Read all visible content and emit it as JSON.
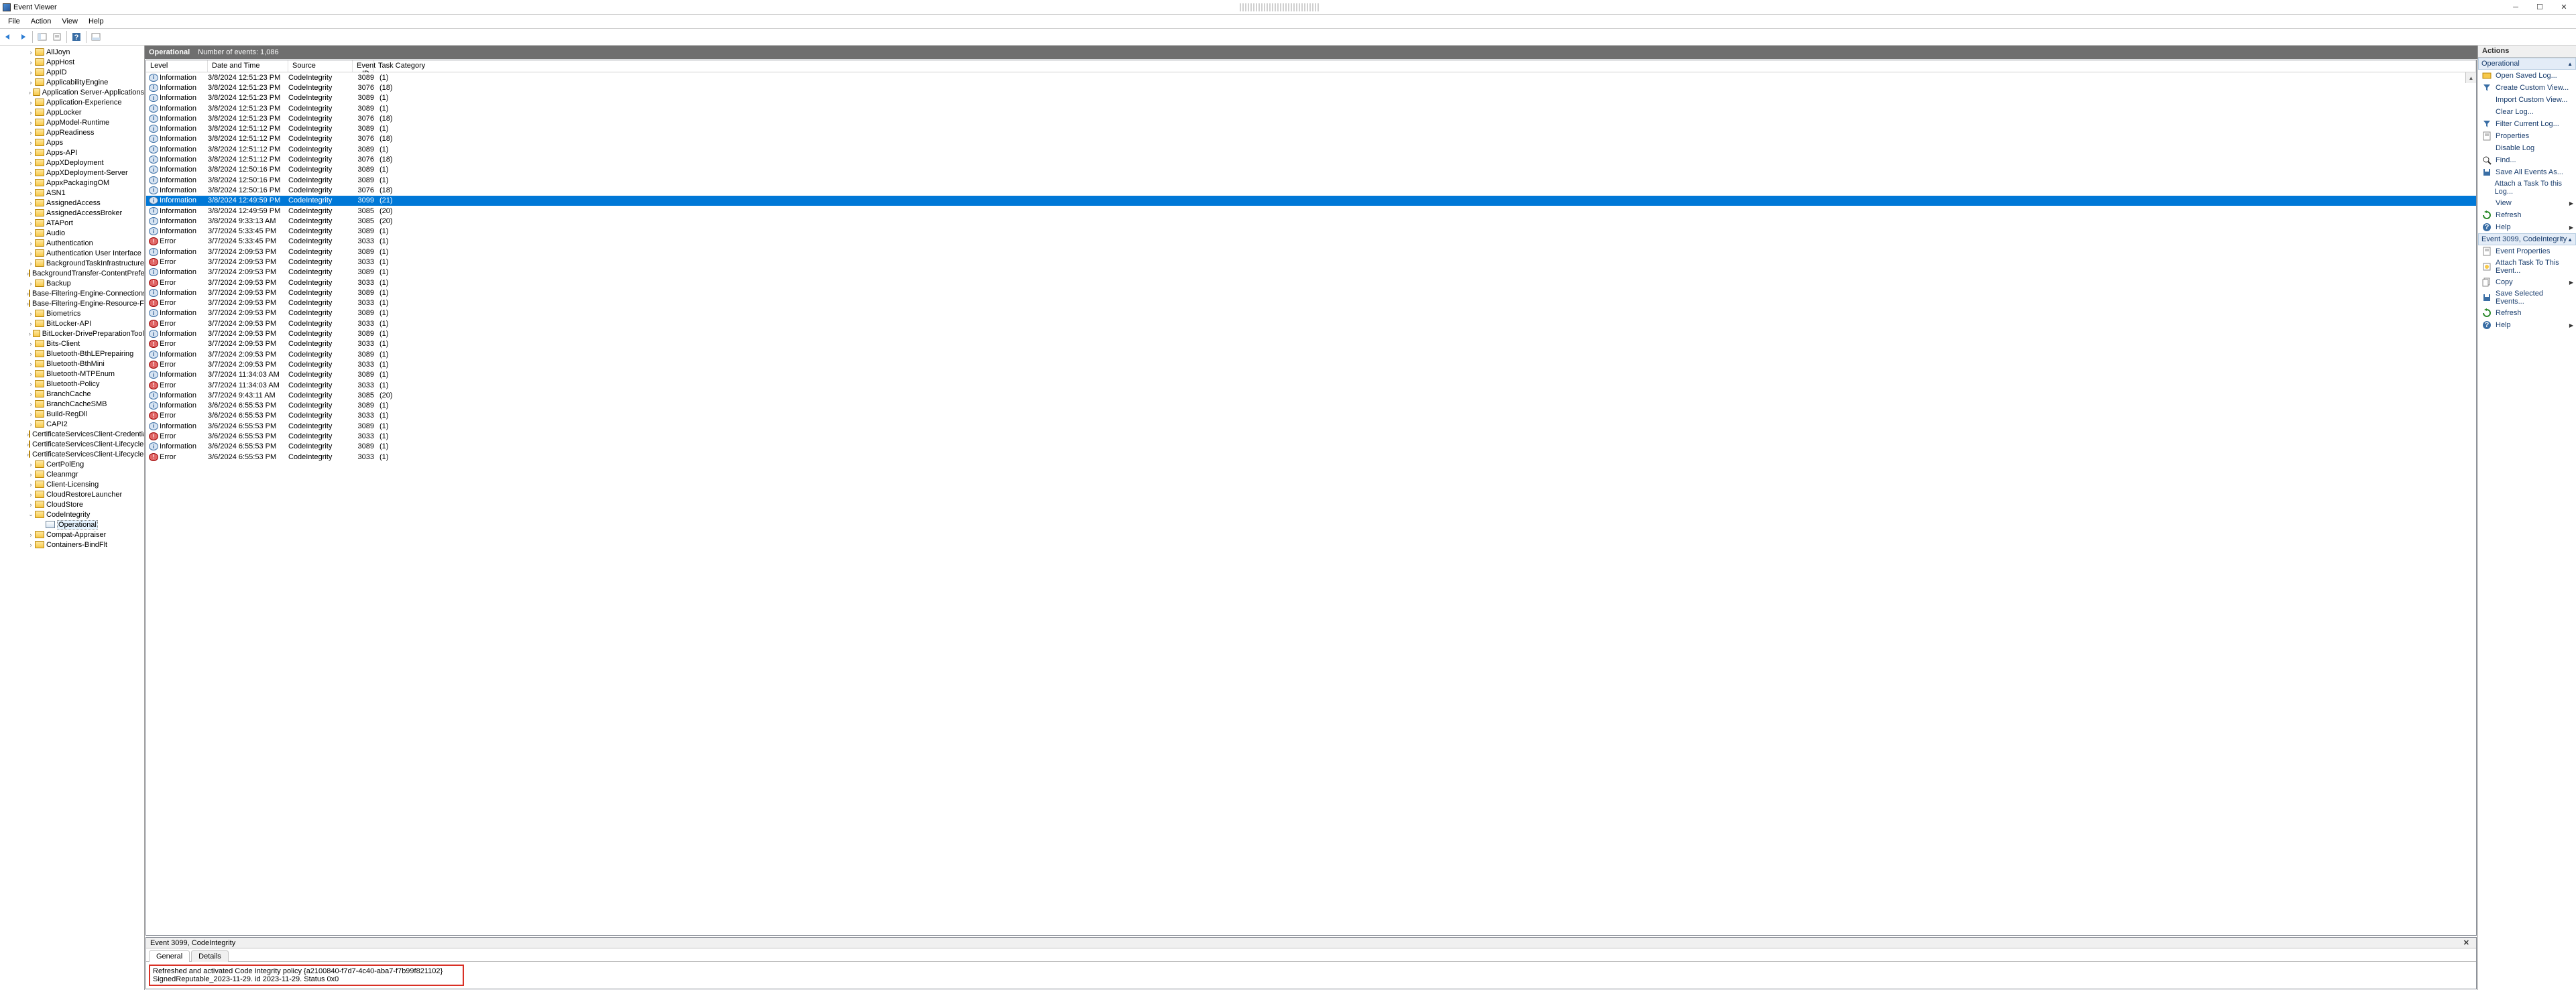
{
  "window": {
    "title": "Event Viewer",
    "menus": [
      "File",
      "Action",
      "View",
      "Help"
    ]
  },
  "tree": {
    "indent_base": 40,
    "items": [
      {
        "label": "AllJoyn",
        "type": "folder"
      },
      {
        "label": "AppHost",
        "type": "folder"
      },
      {
        "label": "AppID",
        "type": "folder"
      },
      {
        "label": "ApplicabilityEngine",
        "type": "folder"
      },
      {
        "label": "Application Server-Applications",
        "type": "folder"
      },
      {
        "label": "Application-Experience",
        "type": "folder"
      },
      {
        "label": "AppLocker",
        "type": "folder"
      },
      {
        "label": "AppModel-Runtime",
        "type": "folder"
      },
      {
        "label": "AppReadiness",
        "type": "folder"
      },
      {
        "label": "Apps",
        "type": "folder"
      },
      {
        "label": "Apps-API",
        "type": "folder"
      },
      {
        "label": "AppXDeployment",
        "type": "folder"
      },
      {
        "label": "AppXDeployment-Server",
        "type": "folder"
      },
      {
        "label": "AppxPackagingOM",
        "type": "folder"
      },
      {
        "label": "ASN1",
        "type": "folder"
      },
      {
        "label": "AssignedAccess",
        "type": "folder"
      },
      {
        "label": "AssignedAccessBroker",
        "type": "folder"
      },
      {
        "label": "ATAPort",
        "type": "folder"
      },
      {
        "label": "Audio",
        "type": "folder"
      },
      {
        "label": "Authentication",
        "type": "folder"
      },
      {
        "label": "Authentication User Interface",
        "type": "folder"
      },
      {
        "label": "BackgroundTaskInfrastructure",
        "type": "folder"
      },
      {
        "label": "BackgroundTransfer-ContentPrefetcher",
        "type": "folder"
      },
      {
        "label": "Backup",
        "type": "folder"
      },
      {
        "label": "Base-Filtering-Engine-Connections",
        "type": "folder"
      },
      {
        "label": "Base-Filtering-Engine-Resource-Flows",
        "type": "folder"
      },
      {
        "label": "Biometrics",
        "type": "folder"
      },
      {
        "label": "BitLocker-API",
        "type": "folder"
      },
      {
        "label": "BitLocker-DrivePreparationTool",
        "type": "folder"
      },
      {
        "label": "Bits-Client",
        "type": "folder"
      },
      {
        "label": "Bluetooth-BthLEPrepairing",
        "type": "folder"
      },
      {
        "label": "Bluetooth-BthMini",
        "type": "folder"
      },
      {
        "label": "Bluetooth-MTPEnum",
        "type": "folder"
      },
      {
        "label": "Bluetooth-Policy",
        "type": "folder"
      },
      {
        "label": "BranchCache",
        "type": "folder"
      },
      {
        "label": "BranchCacheSMB",
        "type": "folder"
      },
      {
        "label": "Build-RegDll",
        "type": "folder"
      },
      {
        "label": "CAPI2",
        "type": "folder"
      },
      {
        "label": "CertificateServicesClient-CredentialRoaming",
        "type": "folder"
      },
      {
        "label": "CertificateServicesClient-Lifecycle-System",
        "type": "folder"
      },
      {
        "label": "CertificateServicesClient-Lifecycle-User",
        "type": "folder"
      },
      {
        "label": "CertPolEng",
        "type": "folder"
      },
      {
        "label": "Cleanmgr",
        "type": "folder"
      },
      {
        "label": "Client-Licensing",
        "type": "folder"
      },
      {
        "label": "CloudRestoreLauncher",
        "type": "folder"
      },
      {
        "label": "CloudStore",
        "type": "folder"
      },
      {
        "label": "CodeIntegrity",
        "type": "folder",
        "expanded": true
      },
      {
        "label": "Operational",
        "type": "log",
        "indent": 56,
        "selected": true
      },
      {
        "label": "Compat-Appraiser",
        "type": "folder"
      },
      {
        "label": "Containers-BindFlt",
        "type": "folder"
      }
    ]
  },
  "log": {
    "name": "Operational",
    "count_label": "Number of events: 1,086",
    "columns": {
      "level": "Level",
      "date": "Date and Time",
      "source": "Source",
      "eid": "Event ID",
      "cat": "Task Category"
    },
    "events": [
      {
        "lvl": "Information",
        "dt": "3/8/2024 12:51:23 PM",
        "src": "CodeIntegrity",
        "id": "3089",
        "cat": "(1)"
      },
      {
        "lvl": "Information",
        "dt": "3/8/2024 12:51:23 PM",
        "src": "CodeIntegrity",
        "id": "3076",
        "cat": "(18)"
      },
      {
        "lvl": "Information",
        "dt": "3/8/2024 12:51:23 PM",
        "src": "CodeIntegrity",
        "id": "3089",
        "cat": "(1)"
      },
      {
        "lvl": "Information",
        "dt": "3/8/2024 12:51:23 PM",
        "src": "CodeIntegrity",
        "id": "3089",
        "cat": "(1)"
      },
      {
        "lvl": "Information",
        "dt": "3/8/2024 12:51:23 PM",
        "src": "CodeIntegrity",
        "id": "3076",
        "cat": "(18)"
      },
      {
        "lvl": "Information",
        "dt": "3/8/2024 12:51:12 PM",
        "src": "CodeIntegrity",
        "id": "3089",
        "cat": "(1)"
      },
      {
        "lvl": "Information",
        "dt": "3/8/2024 12:51:12 PM",
        "src": "CodeIntegrity",
        "id": "3076",
        "cat": "(18)"
      },
      {
        "lvl": "Information",
        "dt": "3/8/2024 12:51:12 PM",
        "src": "CodeIntegrity",
        "id": "3089",
        "cat": "(1)"
      },
      {
        "lvl": "Information",
        "dt": "3/8/2024 12:51:12 PM",
        "src": "CodeIntegrity",
        "id": "3076",
        "cat": "(18)"
      },
      {
        "lvl": "Information",
        "dt": "3/8/2024 12:50:16 PM",
        "src": "CodeIntegrity",
        "id": "3089",
        "cat": "(1)"
      },
      {
        "lvl": "Information",
        "dt": "3/8/2024 12:50:16 PM",
        "src": "CodeIntegrity",
        "id": "3089",
        "cat": "(1)"
      },
      {
        "lvl": "Information",
        "dt": "3/8/2024 12:50:16 PM",
        "src": "CodeIntegrity",
        "id": "3076",
        "cat": "(18)"
      },
      {
        "lvl": "Information",
        "dt": "3/8/2024 12:49:59 PM",
        "src": "CodeIntegrity",
        "id": "3099",
        "cat": "(21)",
        "selected": true
      },
      {
        "lvl": "Information",
        "dt": "3/8/2024 12:49:59 PM",
        "src": "CodeIntegrity",
        "id": "3085",
        "cat": "(20)"
      },
      {
        "lvl": "Information",
        "dt": "3/8/2024 9:33:13 AM",
        "src": "CodeIntegrity",
        "id": "3085",
        "cat": "(20)"
      },
      {
        "lvl": "Information",
        "dt": "3/7/2024 5:33:45 PM",
        "src": "CodeIntegrity",
        "id": "3089",
        "cat": "(1)"
      },
      {
        "lvl": "Error",
        "dt": "3/7/2024 5:33:45 PM",
        "src": "CodeIntegrity",
        "id": "3033",
        "cat": "(1)"
      },
      {
        "lvl": "Information",
        "dt": "3/7/2024 2:09:53 PM",
        "src": "CodeIntegrity",
        "id": "3089",
        "cat": "(1)"
      },
      {
        "lvl": "Error",
        "dt": "3/7/2024 2:09:53 PM",
        "src": "CodeIntegrity",
        "id": "3033",
        "cat": "(1)"
      },
      {
        "lvl": "Information",
        "dt": "3/7/2024 2:09:53 PM",
        "src": "CodeIntegrity",
        "id": "3089",
        "cat": "(1)"
      },
      {
        "lvl": "Error",
        "dt": "3/7/2024 2:09:53 PM",
        "src": "CodeIntegrity",
        "id": "3033",
        "cat": "(1)"
      },
      {
        "lvl": "Information",
        "dt": "3/7/2024 2:09:53 PM",
        "src": "CodeIntegrity",
        "id": "3089",
        "cat": "(1)"
      },
      {
        "lvl": "Error",
        "dt": "3/7/2024 2:09:53 PM",
        "src": "CodeIntegrity",
        "id": "3033",
        "cat": "(1)"
      },
      {
        "lvl": "Information",
        "dt": "3/7/2024 2:09:53 PM",
        "src": "CodeIntegrity",
        "id": "3089",
        "cat": "(1)"
      },
      {
        "lvl": "Error",
        "dt": "3/7/2024 2:09:53 PM",
        "src": "CodeIntegrity",
        "id": "3033",
        "cat": "(1)"
      },
      {
        "lvl": "Information",
        "dt": "3/7/2024 2:09:53 PM",
        "src": "CodeIntegrity",
        "id": "3089",
        "cat": "(1)"
      },
      {
        "lvl": "Error",
        "dt": "3/7/2024 2:09:53 PM",
        "src": "CodeIntegrity",
        "id": "3033",
        "cat": "(1)"
      },
      {
        "lvl": "Information",
        "dt": "3/7/2024 2:09:53 PM",
        "src": "CodeIntegrity",
        "id": "3089",
        "cat": "(1)"
      },
      {
        "lvl": "Error",
        "dt": "3/7/2024 2:09:53 PM",
        "src": "CodeIntegrity",
        "id": "3033",
        "cat": "(1)"
      },
      {
        "lvl": "Information",
        "dt": "3/7/2024 11:34:03 AM",
        "src": "CodeIntegrity",
        "id": "3089",
        "cat": "(1)"
      },
      {
        "lvl": "Error",
        "dt": "3/7/2024 11:34:03 AM",
        "src": "CodeIntegrity",
        "id": "3033",
        "cat": "(1)"
      },
      {
        "lvl": "Information",
        "dt": "3/7/2024 9:43:11 AM",
        "src": "CodeIntegrity",
        "id": "3085",
        "cat": "(20)"
      },
      {
        "lvl": "Information",
        "dt": "3/6/2024 6:55:53 PM",
        "src": "CodeIntegrity",
        "id": "3089",
        "cat": "(1)"
      },
      {
        "lvl": "Error",
        "dt": "3/6/2024 6:55:53 PM",
        "src": "CodeIntegrity",
        "id": "3033",
        "cat": "(1)"
      },
      {
        "lvl": "Information",
        "dt": "3/6/2024 6:55:53 PM",
        "src": "CodeIntegrity",
        "id": "3089",
        "cat": "(1)"
      },
      {
        "lvl": "Error",
        "dt": "3/6/2024 6:55:53 PM",
        "src": "CodeIntegrity",
        "id": "3033",
        "cat": "(1)"
      },
      {
        "lvl": "Information",
        "dt": "3/6/2024 6:55:53 PM",
        "src": "CodeIntegrity",
        "id": "3089",
        "cat": "(1)"
      },
      {
        "lvl": "Error",
        "dt": "3/6/2024 6:55:53 PM",
        "src": "CodeIntegrity",
        "id": "3033",
        "cat": "(1)"
      }
    ]
  },
  "preview": {
    "title": "Event 3099, CodeIntegrity",
    "tabs": {
      "general": "General",
      "details": "Details"
    },
    "message": "Refreshed and activated Code Integrity policy {a2100840-f7d7-4c40-aba7-f7b99f821102} SignedReputable_2023-11-29. id 2023-11-29. Status 0x0"
  },
  "actions": {
    "header": "Actions",
    "section1": {
      "title": "Operational",
      "items": [
        {
          "icon": "open-icon",
          "label": "Open Saved Log..."
        },
        {
          "icon": "filter-icon",
          "label": "Create Custom View..."
        },
        {
          "icon": "",
          "label": "Import Custom View..."
        },
        {
          "icon": "",
          "label": "Clear Log..."
        },
        {
          "icon": "filter-icon",
          "label": "Filter Current Log..."
        },
        {
          "icon": "properties-icon",
          "label": "Properties"
        },
        {
          "icon": "",
          "label": "Disable Log"
        },
        {
          "icon": "find-icon",
          "label": "Find..."
        },
        {
          "icon": "save-icon",
          "label": "Save All Events As..."
        },
        {
          "icon": "",
          "label": "Attach a Task To this Log..."
        },
        {
          "icon": "",
          "label": "View",
          "submenu": true
        },
        {
          "icon": "refresh-icon",
          "label": "Refresh"
        },
        {
          "icon": "help-icon",
          "label": "Help",
          "submenu": true
        }
      ]
    },
    "section2": {
      "title": "Event 3099, CodeIntegrity",
      "items": [
        {
          "icon": "properties-icon",
          "label": "Event Properties"
        },
        {
          "icon": "task-icon",
          "label": "Attach Task To This Event..."
        },
        {
          "icon": "copy-icon",
          "label": "Copy",
          "submenu": true
        },
        {
          "icon": "save-icon",
          "label": "Save Selected Events..."
        },
        {
          "icon": "refresh-icon",
          "label": "Refresh"
        },
        {
          "icon": "help-icon",
          "label": "Help",
          "submenu": true
        }
      ]
    }
  }
}
